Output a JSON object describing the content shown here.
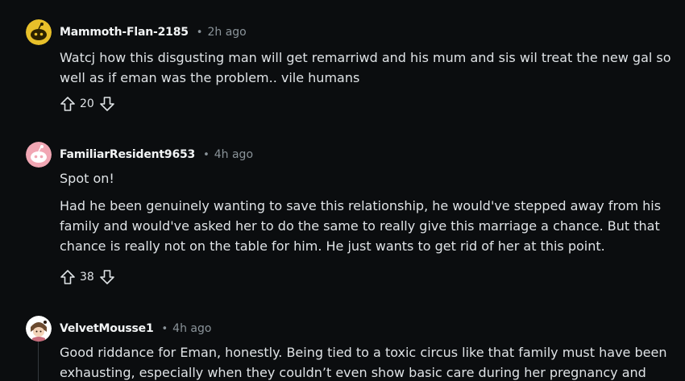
{
  "comments": [
    {
      "username": "Mammoth-Flan-2185",
      "separator": "•",
      "time": "2h ago",
      "paragraphs": [
        "Watcj how this disgusting man will get remarriwd and his mum and sis wil treat the new gal so well as if eman was the problem.. vile humans"
      ],
      "score": "20",
      "avatar_color": "#e8c02a"
    },
    {
      "username": "FamiliarResident9653",
      "separator": "•",
      "time": "4h ago",
      "paragraphs": [
        "Spot on!",
        "Had he been genuinely wanting to save this relationship, he would've stepped away from his family and would've asked her to do the same to really give this marriage a chance. But that chance is really not on the table for him. He just wants to get rid of her at this point."
      ],
      "score": "38",
      "avatar_color": "#f1a7b4"
    },
    {
      "username": "VelvetMousse1",
      "separator": "•",
      "time": "4h ago",
      "paragraphs": [
        "Good riddance for Eman, honestly. Being tied to a toxic circus like that family must have been exhausting, especially when they couldn’t even show basic care during her pregnancy and"
      ],
      "avatar_color": "#ffffff"
    }
  ]
}
